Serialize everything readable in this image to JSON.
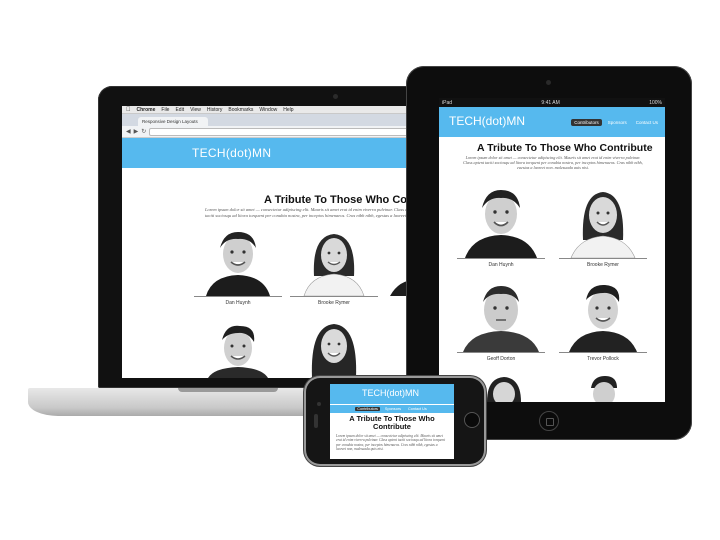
{
  "site": {
    "logo": "TECH(dot)MN",
    "headline": "A Tribute To Those Who Contribute",
    "lorem": "Lorem ipsum dolor sit amet — consectetur adipiscing elit. Mauris sit amet erat id enim viverra pulvinar. Class aptent taciti sociosqu ad litora torquent per conubia nostra, per inceptos himenaeos. Cras nibh nibh, egestas a laoreet non, malesuada quis nisi.",
    "nav": [
      "Contributors",
      "Sponsors",
      "Contact Us"
    ],
    "brand_color": "#56b9ee"
  },
  "laptop": {
    "menubar": [
      "Chrome",
      "File",
      "Edit",
      "View",
      "History",
      "Bookmarks",
      "Window",
      "Help"
    ],
    "tab_title": "Responsive Design Layouts",
    "nav_icons": [
      "back-icon",
      "forward-icon",
      "reload-icon",
      "wrench-icon"
    ]
  },
  "tablet": {
    "status_left": "iPad",
    "status_time": "9:41 AM",
    "status_right": "100%"
  },
  "people": [
    {
      "name": "Dan Huynh"
    },
    {
      "name": "Brooke Rymer"
    },
    {
      "name": "Geoff Dorton"
    },
    {
      "name": "Trevor Pollock"
    }
  ]
}
